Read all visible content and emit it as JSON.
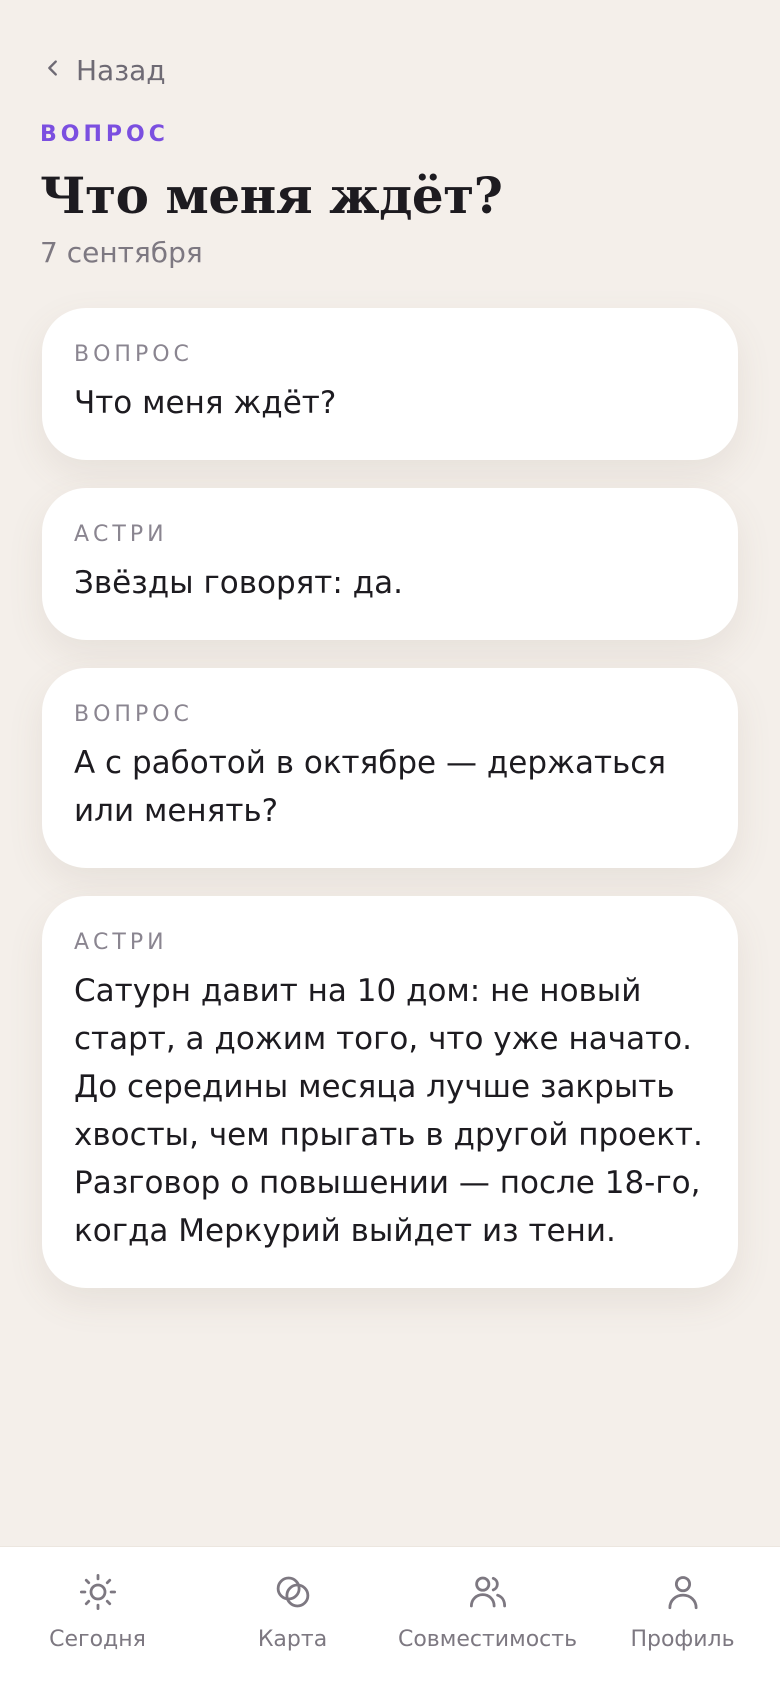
{
  "nav": {
    "back_label": "Назад"
  },
  "header": {
    "eyebrow": "ВОПРОС",
    "title": "Что меня ждёт?",
    "date": "7 сентября"
  },
  "messages": [
    {
      "label": "ВОПРОС",
      "text": "Что меня ждёт?"
    },
    {
      "label": "АСТРИ",
      "text": "Звёзды говорят: да."
    },
    {
      "label": "ВОПРОС",
      "text": "А с работой в октябре — держаться или менять?"
    },
    {
      "label": "АСТРИ",
      "text": "Сатурн давит на 10 дом: не новый старт, а дожим того, что уже начато. До середины месяца лучше закрыть хвосты, чем прыгать в другой проект. Разговор о повышении — после 18-го, когда Меркурий выйдет из тени."
    }
  ],
  "tabs": [
    {
      "label": "Сегодня",
      "icon": "sun-icon"
    },
    {
      "label": "Карта",
      "icon": "rings-icon"
    },
    {
      "label": "Совместимость",
      "icon": "users-icon"
    },
    {
      "label": "Профиль",
      "icon": "user-icon"
    }
  ],
  "colors": {
    "background": "#f4efea",
    "accent": "#7b4fe0",
    "muted": "#7d7881",
    "card": "#ffffff"
  }
}
